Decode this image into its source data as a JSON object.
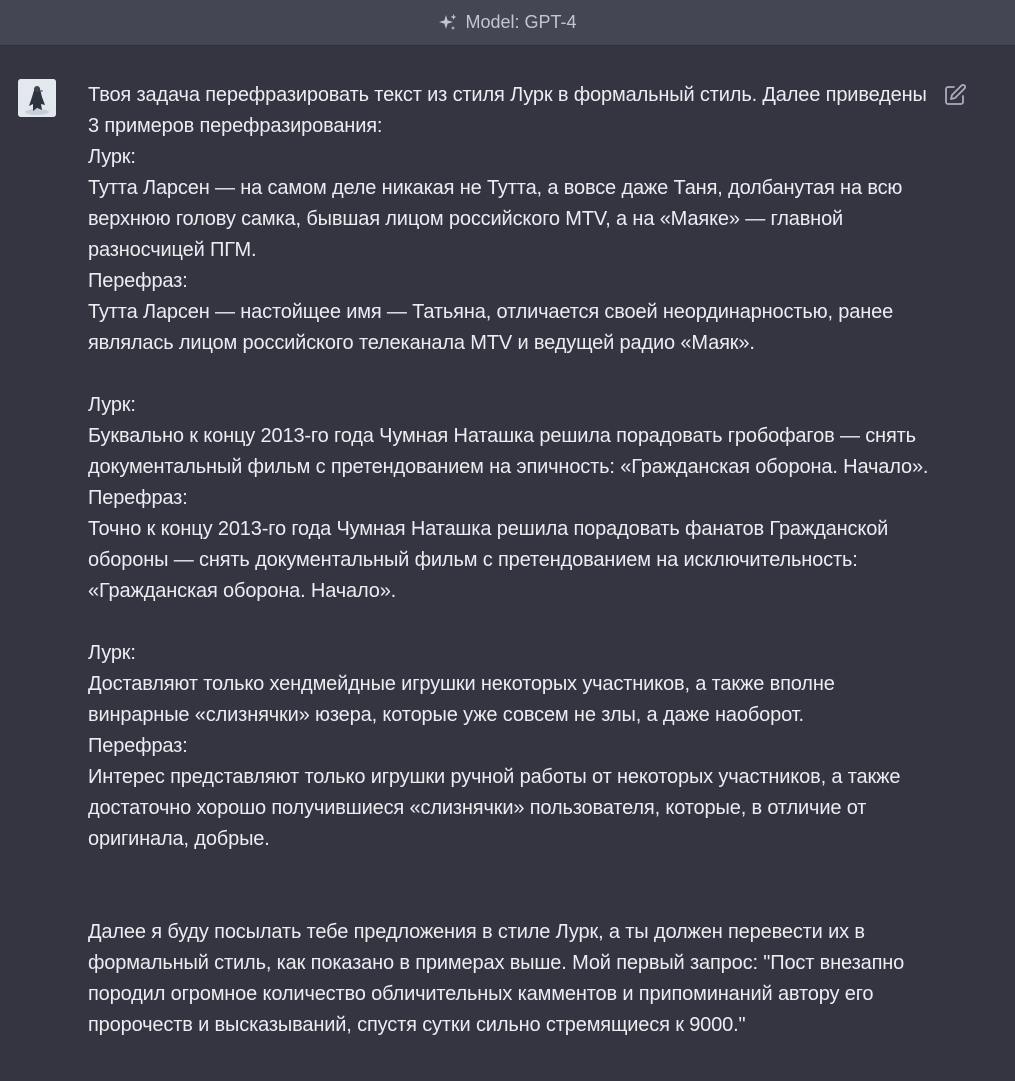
{
  "header": {
    "model_label": "Model: GPT-4",
    "icon": "sparkle-icon"
  },
  "message": {
    "avatar_icon": "user-avatar",
    "edit_icon": "edit-icon",
    "intro": "Твоя задача перефразировать текст из стиля Лурк в формальный стиль. Далее приведены 3 примеров перефразирования:",
    "examples": [
      {
        "lurk_label": "Лурк:",
        "lurk_text": "Тутта Ларсен — на самом деле никакая не Тутта, а вовсе даже Таня, долбанутая на всю верхнюю голову самка, бывшая лицом российского MTV, а на «Маяке» — главной разносчицей ПГМ.",
        "para_label": "Перефраз:",
        "para_text": "Тутта Ларсен — настойщее имя — Татьяна, отличается своей неординарностью, ранее являлась лицом российского телеканала MTV и ведущей радио «Маяк»."
      },
      {
        "lurk_label": "Лурк:",
        "lurk_text": "Буквально к концу 2013-го года Чумная Наташка решила порадовать гробофагов — снять документальный фильм с претендованием на эпичность: «Гражданская оборона. Начало».",
        "para_label": "Перефраз:",
        "para_text": "Точно к концу 2013-го года Чумная Наташка решила порадовать фанатов Гражданской обороны — снять документальный фильм с претендованием на исключительность: «Гражданская оборона. Начало»."
      },
      {
        "lurk_label": "Лурк:",
        "lurk_text": "Доставляют только хендмейдные игрушки некоторых участников, а также вполне винрарные «слизнячки» юзера, которые уже совсем не злы, а даже наоборот.",
        "para_label": "Перефраз:",
        "para_text": "Интерес представляют только игрушки ручной работы от некоторых участников, а также достаточно хорошо получившиеся «слизнячки» пользователя, которые, в отличие от оригинала, добрые."
      }
    ],
    "closing": "Далее я буду посылать тебе предложения в стиле Лурк, а ты должен перевести их в формальный стиль, как показано в примерах выше. Мой первый запрос: \"Пост внезапно породил огромное количество обличительных камментов и припоминаний автору его пророчеств и высказываний, спустя сутки сильно стремящиеся к 9000.\""
  }
}
